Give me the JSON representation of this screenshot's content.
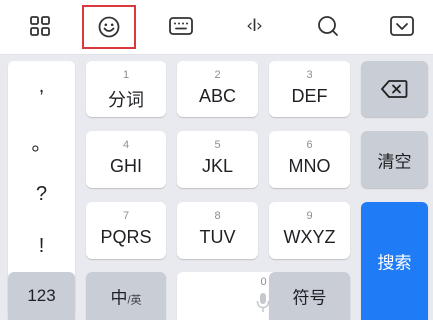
{
  "toolbar": {
    "items": [
      {
        "icon": "grid-icon"
      },
      {
        "icon": "emoji-icon",
        "highlighted": true
      },
      {
        "icon": "keyboard-icon"
      },
      {
        "icon": "cursor-move-icon",
        "label": "‹I›"
      },
      {
        "icon": "search-icon"
      },
      {
        "icon": "collapse-keyboard-icon"
      }
    ]
  },
  "keyboard": {
    "punctuation": [
      ",",
      "。",
      "?",
      "!"
    ],
    "keys": {
      "k1": {
        "num": "1",
        "label": "分词"
      },
      "k2": {
        "num": "2",
        "label": "ABC"
      },
      "k3": {
        "num": "3",
        "label": "DEF"
      },
      "k4": {
        "num": "4",
        "label": "GHI"
      },
      "k5": {
        "num": "5",
        "label": "JKL"
      },
      "k6": {
        "num": "6",
        "label": "MNO"
      },
      "k7": {
        "num": "7",
        "label": "PQRS"
      },
      "k8": {
        "num": "8",
        "label": "TUV"
      },
      "k9": {
        "num": "9",
        "label": "WXYZ"
      },
      "k0": {
        "num": "0"
      }
    },
    "clear": "清空",
    "search": "搜索",
    "num_switch": "123",
    "lang": {
      "main": "中",
      "sub": "/英"
    },
    "symbols": "符号"
  },
  "colors": {
    "accent": "#1f7cf6",
    "highlight_border": "#d9383c"
  }
}
